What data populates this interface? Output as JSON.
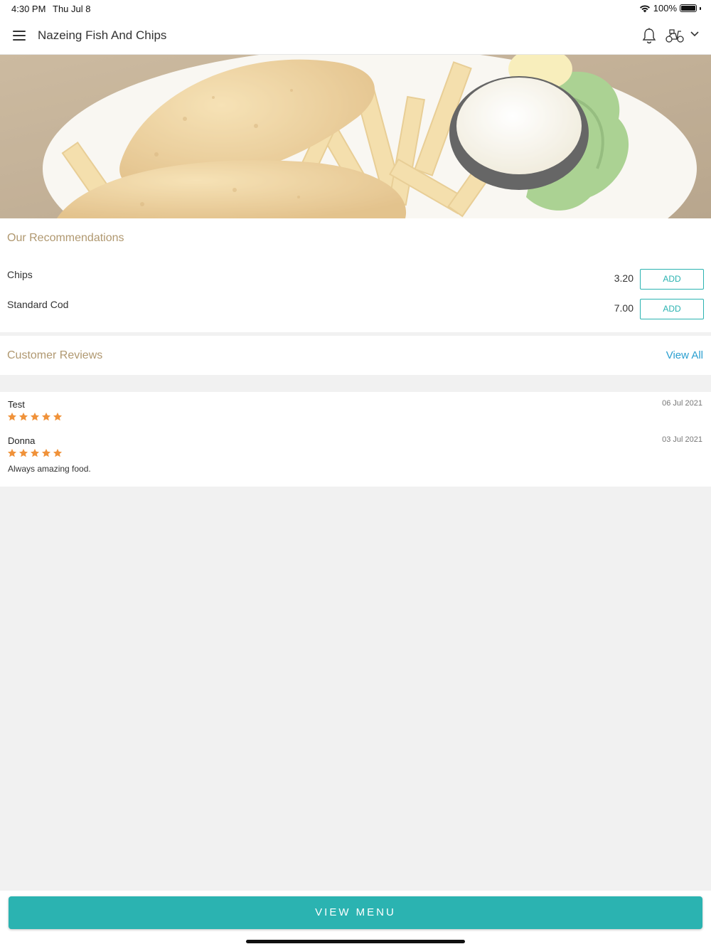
{
  "status_bar": {
    "time": "4:30 PM",
    "date": "Thu Jul 8",
    "battery": "100%",
    "wifi_icon": "wifi-icon",
    "battery_level": 1.0
  },
  "header": {
    "title": "Nazeing Fish And Chips",
    "icons": [
      "menu-icon",
      "bell-icon",
      "scooter-icon",
      "chevron-down-icon"
    ]
  },
  "hero": {
    "image": "fish-and-chips-photo"
  },
  "recommendations": {
    "title": "Our Recommendations",
    "items": [
      {
        "name": "Chips",
        "price": "3.20",
        "button": "ADD"
      },
      {
        "name": "Standard Cod",
        "price": "7.00",
        "button": "ADD"
      }
    ]
  },
  "reviews": {
    "title": "Customer Reviews",
    "view_all": "View All",
    "items": [
      {
        "name": "Test",
        "date": "06 Jul 2021",
        "rating": 5,
        "text": ""
      },
      {
        "name": "Donna",
        "date": "03 Jul 2021",
        "rating": 5,
        "text": "Always amazing food."
      }
    ]
  },
  "footer": {
    "view_menu": "VIEW MENU"
  },
  "colors": {
    "accent": "#2bb3b1",
    "section_title": "#b09870",
    "link": "#2a9fd0",
    "star": "#f0923a"
  }
}
